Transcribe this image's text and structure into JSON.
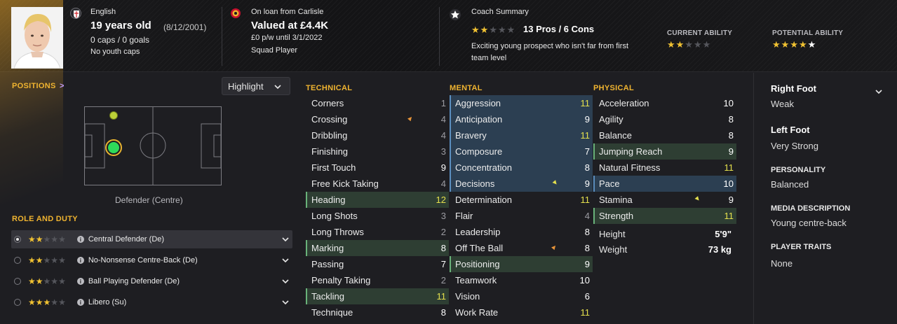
{
  "header": {
    "nationality": "English",
    "age": "19 years old",
    "dob": "(8/12/2001)",
    "caps_goals": "0 caps / 0 goals",
    "youth_caps": "No youth caps",
    "loan_status": "On loan from Carlisle",
    "valuation": "Valued at £4.4K",
    "wage_contract": "£0 p/w until 3/1/2022",
    "squad_status": "Squad Player",
    "coach_summary_title": "Coach Summary",
    "pros_cons": "13 Pros / 6 Cons",
    "coach_summary_stars": 2,
    "coach_summary_text_line1": "Exciting young prospect who isn't far from first",
    "coach_summary_text_line2": "team level",
    "current_ability_label": "CURRENT ABILITY",
    "current_ability_stars": 2,
    "potential_ability_label": "POTENTIAL ABILITY",
    "potential_ability_stars": 4.5
  },
  "positions": {
    "title": "POSITIONS",
    "chevron": ">",
    "highlight_label": "Highlight",
    "position_name": "Defender (Centre)"
  },
  "role_and_duty": {
    "title": "ROLE AND DUTY",
    "roles": [
      {
        "name": "Central Defender (De)",
        "stars": 2,
        "selected": true
      },
      {
        "name": "No-Nonsense Centre-Back (De)",
        "stars": 2,
        "selected": false
      },
      {
        "name": "Ball Playing Defender (De)",
        "stars": 2,
        "selected": false
      },
      {
        "name": "Libero (Su)",
        "stars": 3,
        "selected": false
      }
    ]
  },
  "technical": {
    "title": "TECHNICAL",
    "attributes": [
      {
        "name": "Corners",
        "value": "1"
      },
      {
        "name": "Crossing",
        "value": "4"
      },
      {
        "name": "Dribbling",
        "value": "4"
      },
      {
        "name": "Finishing",
        "value": "3"
      },
      {
        "name": "First Touch",
        "value": "9"
      },
      {
        "name": "Free Kick Taking",
        "value": "4"
      },
      {
        "name": "Heading",
        "value": "12"
      },
      {
        "name": "Long Shots",
        "value": "3"
      },
      {
        "name": "Long Throws",
        "value": "2"
      },
      {
        "name": "Marking",
        "value": "8"
      },
      {
        "name": "Passing",
        "value": "7"
      },
      {
        "name": "Penalty Taking",
        "value": "2"
      },
      {
        "name": "Tackling",
        "value": "11"
      },
      {
        "name": "Technique",
        "value": "8"
      }
    ]
  },
  "mental": {
    "title": "MENTAL",
    "attributes": [
      {
        "name": "Aggression",
        "value": "11"
      },
      {
        "name": "Anticipation",
        "value": "9"
      },
      {
        "name": "Bravery",
        "value": "11"
      },
      {
        "name": "Composure",
        "value": "7"
      },
      {
        "name": "Concentration",
        "value": "8"
      },
      {
        "name": "Decisions",
        "value": "9"
      },
      {
        "name": "Determination",
        "value": "11"
      },
      {
        "name": "Flair",
        "value": "4"
      },
      {
        "name": "Leadership",
        "value": "8"
      },
      {
        "name": "Off The Ball",
        "value": "8"
      },
      {
        "name": "Positioning",
        "value": "9"
      },
      {
        "name": "Teamwork",
        "value": "10"
      },
      {
        "name": "Vision",
        "value": "6"
      },
      {
        "name": "Work Rate",
        "value": "11"
      }
    ]
  },
  "physical": {
    "title": "PHYSICAL",
    "attributes": [
      {
        "name": "Acceleration",
        "value": "10"
      },
      {
        "name": "Agility",
        "value": "8"
      },
      {
        "name": "Balance",
        "value": "8"
      },
      {
        "name": "Jumping Reach",
        "value": "9"
      },
      {
        "name": "Natural Fitness",
        "value": "11"
      },
      {
        "name": "Pace",
        "value": "10"
      },
      {
        "name": "Stamina",
        "value": "9"
      },
      {
        "name": "Strength",
        "value": "11"
      }
    ],
    "height_label": "Height",
    "height_value": "5'9\"",
    "weight_label": "Weight",
    "weight_value": "73 kg"
  },
  "side": {
    "right_foot_label": "Right Foot",
    "right_foot_value": "Weak",
    "left_foot_label": "Left Foot",
    "left_foot_value": "Very Strong",
    "personality_label": "PERSONALITY",
    "personality_value": "Balanced",
    "media_label": "MEDIA DESCRIPTION",
    "media_value": "Young centre-back",
    "traits_label": "PLAYER TRAITS",
    "traits_value": "None"
  },
  "colors": {
    "accent": "#f0b430",
    "star_on": "#f1c232",
    "highlight_green": "#2e3e33",
    "highlight_blue": "#2c3f52",
    "value_yellow": "#e5e04d",
    "arrow_orange": "#e8953a",
    "arrow_yellow": "#e5e04d"
  }
}
